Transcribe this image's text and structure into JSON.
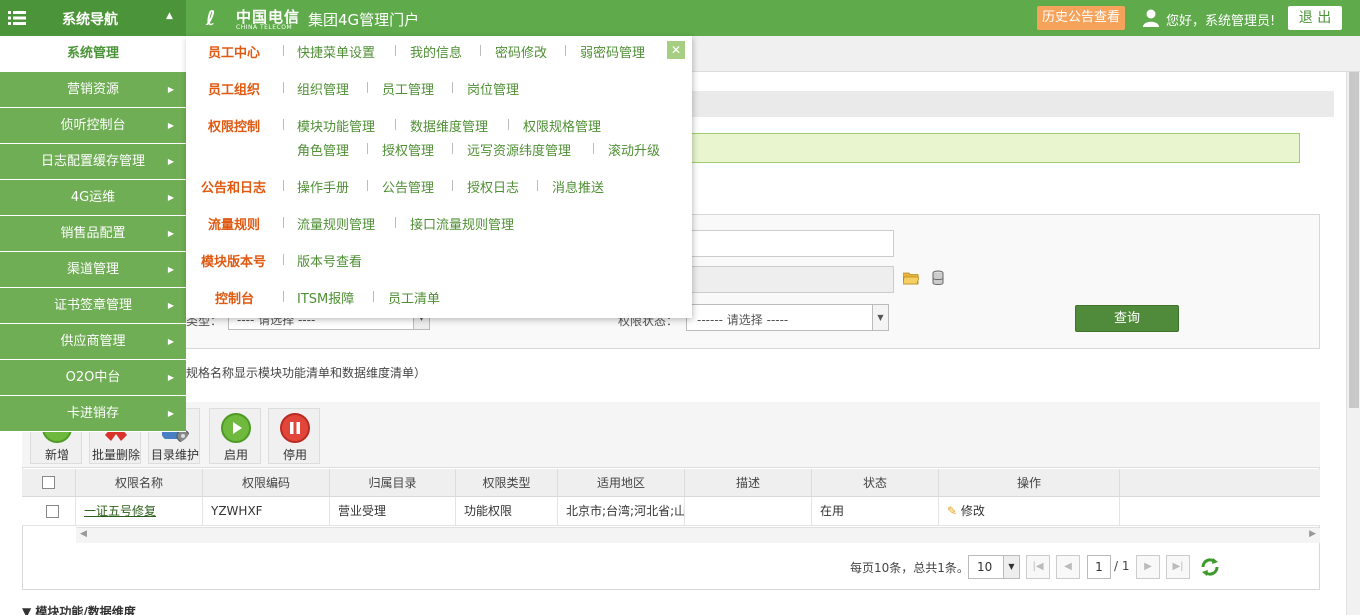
{
  "header": {
    "nav_title": "系统导航",
    "brand_cn": "中国电信",
    "brand_en": "CHINA TELECOM",
    "portal_title": "集团4G管理门户",
    "history_button": "历史公告查看",
    "greeting": "您好，系统管理员!",
    "logout_button": "退 出"
  },
  "sidebar": {
    "items": [
      {
        "label": "系统管理",
        "active": true
      },
      {
        "label": "营销资源"
      },
      {
        "label": "侦听控制台"
      },
      {
        "label": "日志配置缓存管理"
      },
      {
        "label": "4G运维"
      },
      {
        "label": "销售品配置"
      },
      {
        "label": "渠道管理"
      },
      {
        "label": "证书签章管理"
      },
      {
        "label": "供应商管理"
      },
      {
        "label": "O2O中台"
      },
      {
        "label": "卡进销存"
      }
    ]
  },
  "dropdown": {
    "close": "✕",
    "groups": [
      {
        "title": "员工中心",
        "links": [
          "快捷菜单设置",
          "我的信息",
          "密码修改",
          "弱密码管理"
        ]
      },
      {
        "title": "员工组织",
        "links": [
          "组织管理",
          "员工管理",
          "岗位管理"
        ]
      },
      {
        "title": "权限控制",
        "links": [
          "模块功能管理",
          "数据维度管理",
          "权限规格管理",
          "角色管理",
          "授权管理",
          "远写资源纬度管理",
          "滚动升级"
        ]
      },
      {
        "title": "公告和日志",
        "links": [
          "操作手册",
          "公告管理",
          "授权日志",
          "消息推送"
        ]
      },
      {
        "title": "流量规则",
        "links": [
          "流量规则管理",
          "接口流量规则管理"
        ]
      },
      {
        "title": "模块版本号",
        "links": [
          "版本号查看"
        ]
      },
      {
        "title": "控制台",
        "links": [
          "ITSM报障",
          "员工清单"
        ]
      }
    ]
  },
  "search": {
    "type_label": "类型：",
    "type_select": "---- 请选择 ----",
    "status_label": "权限状态：",
    "status_select": "------ 请选择 -----",
    "query_button": "查询",
    "hint": "规格名称显示模块功能清单和数据维度清单）"
  },
  "toolbar": {
    "add": "新增",
    "batch_delete": "批量删除",
    "dir_maintain": "目录维护",
    "enable": "启用",
    "disable": "停用"
  },
  "table": {
    "headers": [
      "权限名称",
      "权限编码",
      "归属目录",
      "权限类型",
      "适用地区",
      "描述",
      "状态",
      "操作"
    ],
    "rows": [
      {
        "name": "一证五号修复",
        "code": "YZWHXF",
        "dir": "营业受理",
        "type": "功能权限",
        "region": "北京市;台湾;河北省;山",
        "desc": "",
        "status": "在用",
        "action": "修改"
      }
    ]
  },
  "pager": {
    "summary": "每页10条，总共1条。",
    "page_size": "10",
    "current_page": "1",
    "total_pages": "/ 1"
  },
  "bottom_section_title": "模块功能/数据维度"
}
